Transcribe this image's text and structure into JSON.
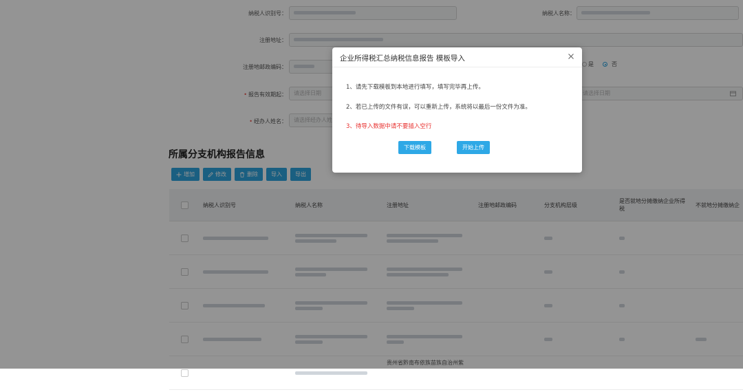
{
  "form": {
    "taxpayer_id_label": "纳税人识别号：",
    "taxpayer_name_label": "纳税人名称：",
    "reg_address_label": "注册地址：",
    "reg_postcode_label": "注册地邮政编码：",
    "report_period_label": "报告有效期起：",
    "report_period_placeholder": "请选择日期",
    "report_period_end_placeholder": "请选择日期",
    "handler_label": "经办人姓名：",
    "handler_placeholder": "请选择经办人姓名",
    "radio_yes": "是",
    "radio_no": "否"
  },
  "section_title": "所属分支机构报告信息",
  "toolbar": {
    "add": "增加",
    "edit": "修改",
    "delete": "删除",
    "import": "导入",
    "export": "导出"
  },
  "table": {
    "headers": [
      "纳税人识别号",
      "纳税人名称",
      "注册地址",
      "注册地邮政编码",
      "分支机构层级",
      "是否就地分摊缴纳企业所得税",
      "不就地分摊缴纳企"
    ],
    "last_row_address": "贵州省黔南布依族苗族自治州紫"
  },
  "modal": {
    "title": "企业所得税汇总纳税信息报告 模板导入",
    "line1": "1、请先下载模板到本地进行填写，填写完毕再上传。",
    "line2": "2、若已上传的文件有误，可以重新上传，系统将以最后一份文件为准。",
    "line3": "3、待导入数据中请不要插入空行",
    "download_button": "下载模板",
    "upload_button": "开始上传"
  }
}
